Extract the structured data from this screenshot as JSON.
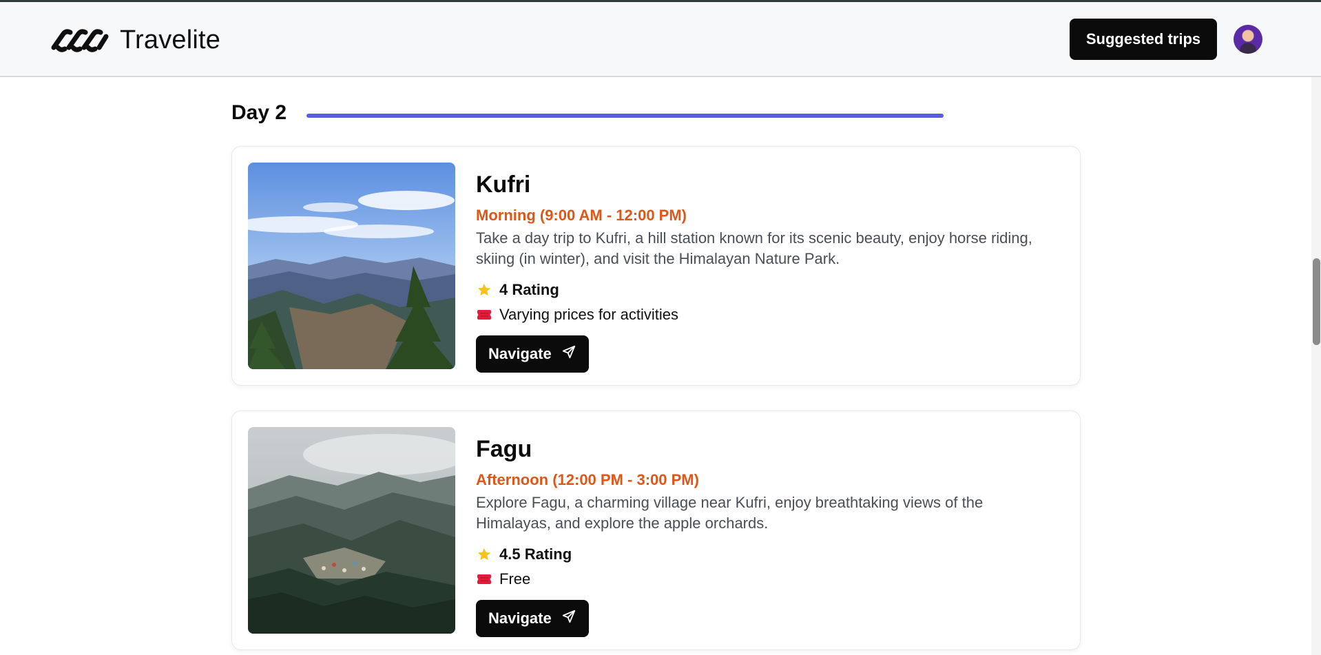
{
  "header": {
    "brand": "Travelite",
    "suggested_trips_label": "Suggested trips"
  },
  "itinerary": {
    "day_title": "Day 2",
    "places": [
      {
        "name": "Kufri",
        "time": "Morning (9:00 AM - 12:00 PM)",
        "description": "Take a day trip to Kufri, a hill station known for its scenic beauty, enjoy horse riding, skiing (in winter), and visit the Himalayan Nature Park.",
        "rating": "4 Rating",
        "price": "Varying prices for activities",
        "navigate_label": "Navigate"
      },
      {
        "name": "Fagu",
        "time": "Afternoon (12:00 PM - 3:00 PM)",
        "description": "Explore Fagu, a charming village near Kufri, enjoy breathtaking views of the Himalayas, and explore the apple orchards.",
        "rating": "4.5 Rating",
        "price": "Free",
        "navigate_label": "Navigate"
      }
    ]
  },
  "icons": {
    "logo": "infinity-links-logo",
    "rating": "star-icon",
    "price": "ticket-icon",
    "navigate": "send-arrow-icon"
  },
  "colors": {
    "accent_line": "#5a5ce0",
    "time_slot": "#e05616",
    "button_bg": "#0b0b0b",
    "star": "#f6c21b",
    "ticket": "#e21d3a"
  }
}
